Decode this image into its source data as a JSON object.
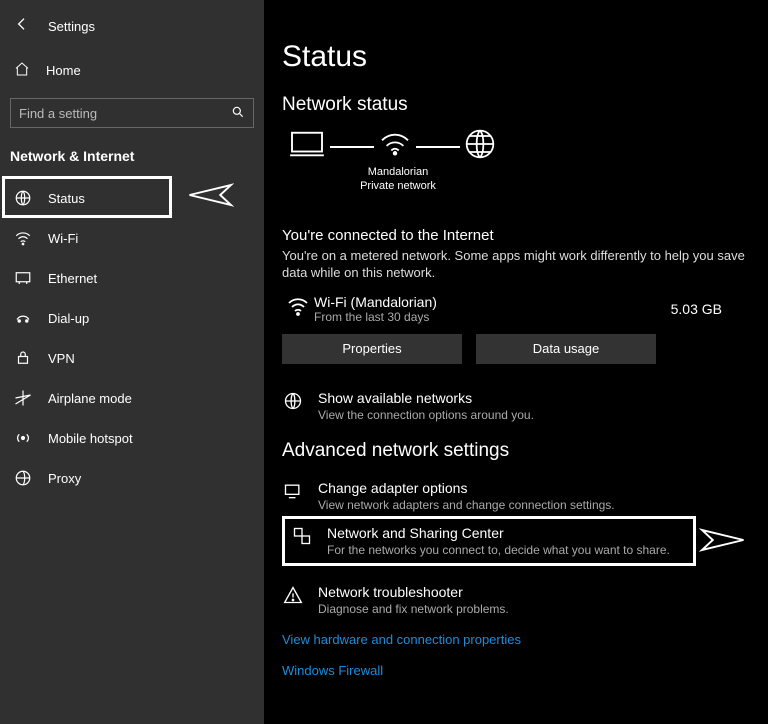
{
  "header": {
    "title": "Settings"
  },
  "sidebar": {
    "home": "Home",
    "search_placeholder": "Find a setting",
    "section": "Network & Internet",
    "items": [
      {
        "label": "Status"
      },
      {
        "label": "Wi-Fi"
      },
      {
        "label": "Ethernet"
      },
      {
        "label": "Dial-up"
      },
      {
        "label": "VPN"
      },
      {
        "label": "Airplane mode"
      },
      {
        "label": "Mobile hotspot"
      },
      {
        "label": "Proxy"
      }
    ]
  },
  "main": {
    "title": "Status",
    "status_heading": "Network status",
    "diagram": {
      "name": "Mandalorian",
      "type": "Private network"
    },
    "connected_title": "You're connected to the Internet",
    "connected_body": "You're on a metered network. Some apps might work differently to help you save data while on this network.",
    "wifi": {
      "name": "Wi-Fi (Mandalorian)",
      "sub": "From the last 30 days",
      "usage": "5.03 GB"
    },
    "buttons": {
      "properties": "Properties",
      "data_usage": "Data usage"
    },
    "show_networks": {
      "title": "Show available networks",
      "sub": "View the connection options around you."
    },
    "advanced_heading": "Advanced network settings",
    "adapter": {
      "title": "Change adapter options",
      "sub": "View network adapters and change connection settings."
    },
    "sharing": {
      "title": "Network and Sharing Center",
      "sub": "For the networks you connect to, decide what you want to share."
    },
    "troubleshoot": {
      "title": "Network troubleshooter",
      "sub": "Diagnose and fix network problems."
    },
    "link_hardware": "View hardware and connection properties",
    "link_firewall": "Windows Firewall"
  }
}
